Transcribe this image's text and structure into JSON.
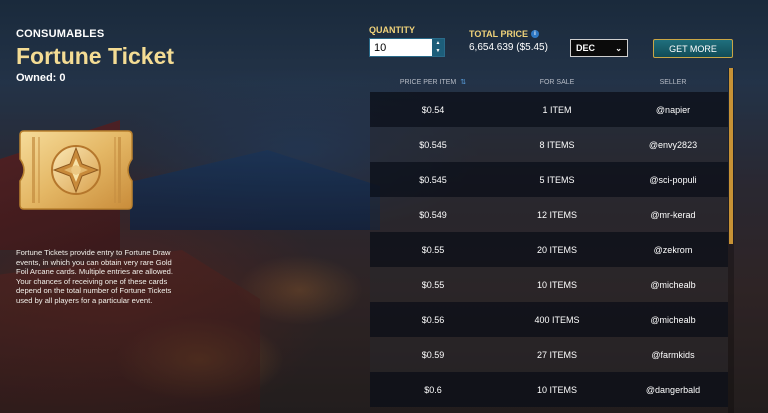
{
  "item": {
    "category": "CONSUMABLES",
    "name": "Fortune Ticket",
    "owned": "Owned: 0",
    "description": "Fortune Tickets provide entry to Fortune Draw events, in which you can obtain very rare Gold Foil Arcane cards. Multiple entries are allowed. Your chances of receiving one of these cards depend on the total number of Fortune Tickets used by all players for a particular event."
  },
  "purchase": {
    "quantity_label": "QUANTITY",
    "quantity_value": "10",
    "total_price_label": "TOTAL PRICE",
    "total_price_value": "6,654.639 ($5.45)",
    "currency": "DEC",
    "get_more_label": "GET MORE"
  },
  "table": {
    "headers": [
      "PRICE PER ITEM",
      "FOR SALE",
      "SELLER"
    ],
    "rows": [
      [
        "$0.54",
        "1 ITEM",
        "@napier"
      ],
      [
        "$0.545",
        "8 ITEMS",
        "@envy2823"
      ],
      [
        "$0.545",
        "5 ITEMS",
        "@sci-populi"
      ],
      [
        "$0.549",
        "12 ITEMS",
        "@mr-kerad"
      ],
      [
        "$0.55",
        "20 ITEMS",
        "@zekrom"
      ],
      [
        "$0.55",
        "10 ITEMS",
        "@michealb"
      ],
      [
        "$0.56",
        "400 ITEMS",
        "@michealb"
      ],
      [
        "$0.59",
        "27 ITEMS",
        "@farmkids"
      ],
      [
        "$0.6",
        "10 ITEMS",
        "@dangerbald"
      ]
    ]
  },
  "icons": {
    "info": "info-icon",
    "sort": "sort-icon",
    "ticket": "fortune-ticket-icon"
  },
  "colors": {
    "title": "#f4dc94",
    "label": "#f0d27a",
    "button": "#1f6f7d",
    "scroll": "#c79235"
  }
}
